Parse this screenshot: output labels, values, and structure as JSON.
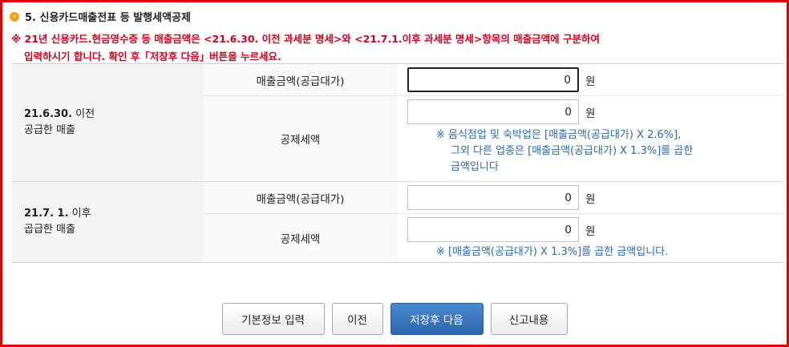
{
  "section": {
    "number_icon": "chevron-right-icon",
    "title": "5. 신용카드매출전표 등 발행세액공제"
  },
  "notice": {
    "line1": "※ 21년 신용카드.현금영수증 등 매출금액은 <21.6.30. 이전 과세분 명세>와 <21.7.1.이후 과세분 명세>항목의 매출금액에 구분하여",
    "line2": "입력하시기 합니다. 확인 후「저장후 다음」버튼을 누르세요."
  },
  "groups": [
    {
      "label_bold": "21.6.30.",
      "label_rest": " 이전",
      "label_line2": "공급한 매출",
      "rows": [
        {
          "label": "매출금액(공급대가)",
          "value": "0",
          "unit": "원"
        },
        {
          "label": "공제세액",
          "value": "0",
          "unit": "원",
          "hint_lines": [
            "※ 음식점업 및 숙박업은 [매출금액(공급대가) X 2.6%],",
            "그외 다른 업종은 [매출금액(공급대가) X 1.3%]를 곱한",
            "금액입니다"
          ]
        }
      ]
    },
    {
      "label_bold": "21.7. 1.",
      "label_rest": " 이후",
      "label_line2": "곱급한 매출",
      "rows": [
        {
          "label": "매출금액(공급대가)",
          "value": "0",
          "unit": "원"
        },
        {
          "label": "공제세액",
          "value": "0",
          "unit": "원",
          "hint_lines": [
            "※ [매출금액(공급대가) X 1.3%]를 곱한 금액입니다."
          ]
        }
      ]
    }
  ],
  "buttons": {
    "basic_info": "기본정보 입력",
    "prev": "이전",
    "save_next": "저장후 다음",
    "report": "신고내용"
  },
  "colors": {
    "frame": "#e00000",
    "notice": "#d4001c",
    "hint": "#2a68b0",
    "primary": "#2d66ad"
  }
}
